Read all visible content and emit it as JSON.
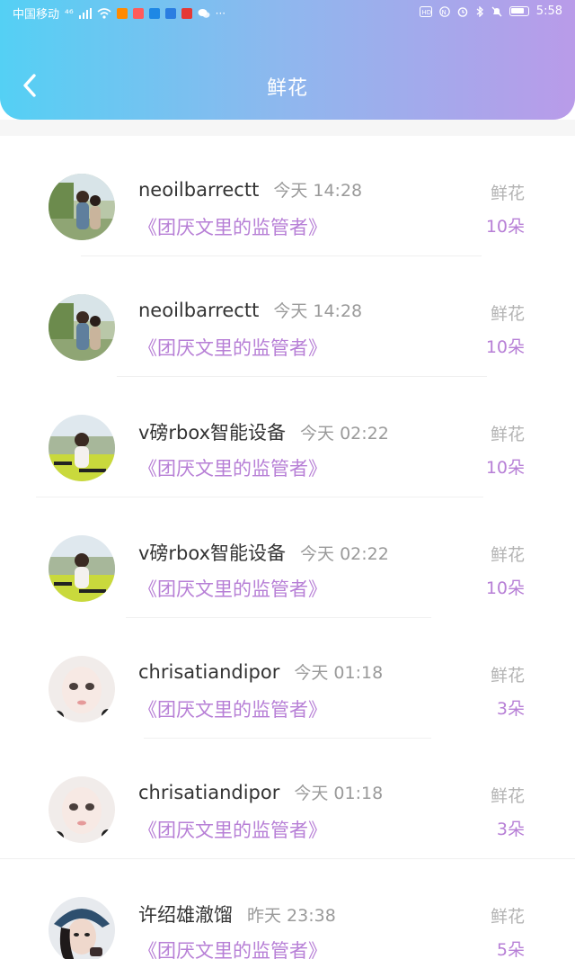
{
  "status_bar": {
    "carrier": "中国移动",
    "network": "⁴⁶",
    "time": "5:58"
  },
  "header": {
    "title": "鲜花",
    "back_icon": "chevron-left-icon"
  },
  "colors": {
    "gradient_start": "#54d0f4",
    "gradient_end": "#b99be9",
    "accent_purple": "#b77fd6",
    "name_text": "#333333",
    "muted_text": "#9a9a9a"
  },
  "items": [
    {
      "name": "neoilbarrectt",
      "time": "今天 14:28",
      "book": "《团厌文里的监管者》",
      "type": "鲜花",
      "count": "10朵",
      "avatar": "couple-photo"
    },
    {
      "name": "neoilbarrectt",
      "time": "今天 14:28",
      "book": "《团厌文里的监管者》",
      "type": "鲜花",
      "count": "10朵",
      "avatar": "couple-photo"
    },
    {
      "name": "v磅rbox智能设备",
      "time": "今天 02:22",
      "book": "《团厌文里的监管者》",
      "type": "鲜花",
      "count": "10朵",
      "avatar": "girl-field-photo"
    },
    {
      "name": "v磅rbox智能设备",
      "time": "今天 02:22",
      "book": "《团厌文里的监管者》",
      "type": "鲜花",
      "count": "10朵",
      "avatar": "girl-field-photo"
    },
    {
      "name": "chrisatiandipor",
      "time": "今天 01:18",
      "book": "《团厌文里的监管者》",
      "type": "鲜花",
      "count": "3朵",
      "avatar": "doll-face-photo"
    },
    {
      "name": "chrisatiandipor",
      "time": "今天 01:18",
      "book": "《团厌文里的监管者》",
      "type": "鲜花",
      "count": "3朵",
      "avatar": "doll-face-photo"
    },
    {
      "name": "许绍雄澈馏",
      "time": "昨天 23:38",
      "book": "《团厌文里的监管者》",
      "type": "鲜花",
      "count": "5朵",
      "avatar": "hat-girl-photo"
    }
  ]
}
